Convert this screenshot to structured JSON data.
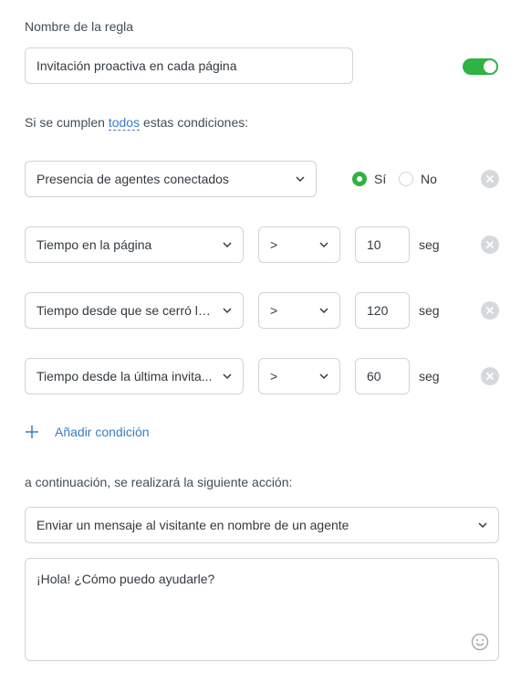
{
  "rule": {
    "name_label": "Nombre de la regla",
    "name_value": "Invitación proactiva en cada página",
    "enabled": true
  },
  "conditions_header": {
    "prefix": "Si se cumplen",
    "mode_link": "todos",
    "suffix": "estas condiciones:"
  },
  "conditions": [
    {
      "field": "Presencia de agentes conectados",
      "options": [
        {
          "label": "Sí",
          "selected": true
        },
        {
          "label": "No",
          "selected": false
        }
      ]
    },
    {
      "field": "Tiempo en la página",
      "operator": ">",
      "value": "10",
      "unit": "seg"
    },
    {
      "field": "Tiempo desde que se cerró la ...",
      "operator": ">",
      "value": "120",
      "unit": "seg"
    },
    {
      "field": "Tiempo desde la última invita...",
      "operator": ">",
      "value": "60",
      "unit": "seg"
    }
  ],
  "add_condition_label": "Añadir condición",
  "action": {
    "label": "a continuación, se realizará la siguiente acción:",
    "selected": "Enviar un mensaje al visitante en nombre de un agente",
    "message": "¡Hola! ¿Cómo puedo ayudarle?"
  },
  "icons": {
    "toggle": "toggle-switch-icon",
    "chevron": "chevron-down-icon",
    "remove": "close-circle-icon",
    "add": "plus-icon",
    "emoji": "smiley-icon"
  },
  "colors": {
    "accent_green": "#2fb344",
    "link_blue": "#3b7cc4",
    "border": "#cfd4d9"
  }
}
